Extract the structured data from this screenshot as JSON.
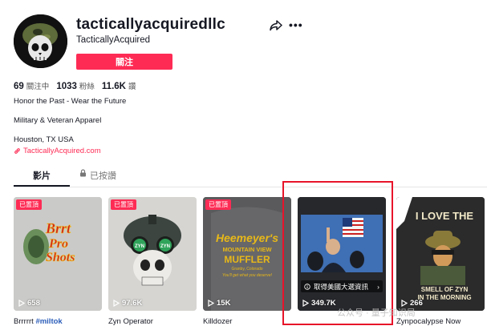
{
  "profile": {
    "username": "tacticallyacquiredllc",
    "nickname": "TacticallyAcquired",
    "follow_label": "關注"
  },
  "stats": [
    {
      "value": "69",
      "label": "關注中"
    },
    {
      "value": "1033",
      "label": "粉絲"
    },
    {
      "value": "11.6K",
      "label": "讚"
    }
  ],
  "bio": {
    "line1": "Honor the Past - Wear the Future",
    "line2": "Military & Veteran Apparel",
    "line3": "Houston, TX USA",
    "link": "TacticallyAcquired.com"
  },
  "tabs": [
    {
      "label": "影片"
    },
    {
      "label": "已按讚"
    }
  ],
  "videos": [
    {
      "views": "658",
      "pinned": "已置頂",
      "caption": "Brrrrrt ",
      "caption_tag": "#miltok",
      "art_text": [
        "Brrt",
        "Pro",
        "Shots"
      ]
    },
    {
      "views": "97.6K",
      "pinned": "已置頂",
      "caption": "Zyn Operator",
      "art_text": [
        "ZYN",
        "ZYN"
      ]
    },
    {
      "views": "15K",
      "pinned": "已置頂",
      "caption": "Killdozer",
      "art_text": [
        "Heemeyer's",
        "MOUNTAIN VIEW",
        "MUFFLER",
        "Granby, Colorado",
        "You'll get what you deserve!"
      ]
    },
    {
      "views": "349.7K",
      "caption": "",
      "info_label": "取得美國大選資訊"
    },
    {
      "views": "266",
      "caption": "Zynpocalypse Now",
      "art_text": [
        "I LOVE THE",
        "SMELL OF ZYN",
        "IN THE MORNING"
      ]
    }
  ],
  "watermark": "公众号 · 量子知识局",
  "colors": {
    "accent": "#fe2c55",
    "highlight_box": "#e8142a"
  }
}
